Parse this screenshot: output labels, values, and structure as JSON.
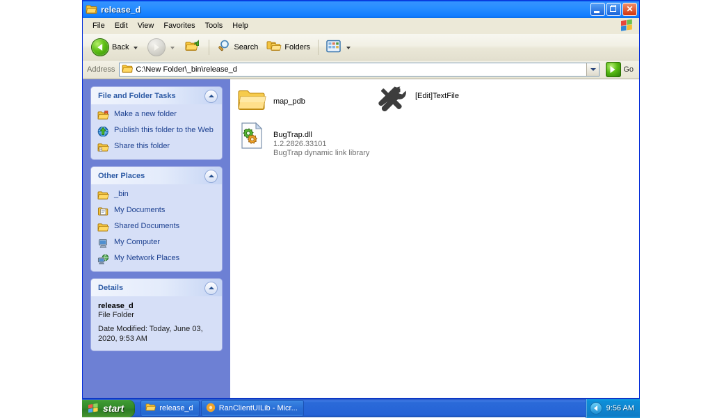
{
  "window": {
    "title": "release_d",
    "title_icon": "folder-icon",
    "controls": {
      "minimize": "Minimize",
      "restore": "Restore",
      "close": "Close"
    }
  },
  "menu": {
    "items": [
      {
        "label": "File",
        "name": "menu-file"
      },
      {
        "label": "Edit",
        "name": "menu-edit"
      },
      {
        "label": "View",
        "name": "menu-view"
      },
      {
        "label": "Favorites",
        "name": "menu-favorites"
      },
      {
        "label": "Tools",
        "name": "menu-tools"
      },
      {
        "label": "Help",
        "name": "menu-help"
      }
    ],
    "logo": "windows-flag-icon"
  },
  "toolbar": {
    "back_label": "Back",
    "forward_label": "",
    "up_label": "",
    "search_label": "Search",
    "folders_label": "Folders",
    "views_label": ""
  },
  "address": {
    "label": "Address",
    "value": "C:\\New Folder\\_bin\\release_d",
    "placeholder": "C:\\New Folder\\_bin\\release_d",
    "go_label": "Go"
  },
  "sidebar": {
    "panels": [
      {
        "title": "File and Folder Tasks",
        "name": "panel-file-and-folder-tasks",
        "items": [
          {
            "label": "Make a new folder",
            "icon": "new-folder-icon"
          },
          {
            "label": "Publish this folder to the Web",
            "icon": "publish-web-icon"
          },
          {
            "label": "Share this folder",
            "icon": "share-folder-icon"
          }
        ]
      },
      {
        "title": "Other Places",
        "name": "panel-other-places",
        "items": [
          {
            "label": "_bin",
            "icon": "folder-icon"
          },
          {
            "label": "My Documents",
            "icon": "my-documents-icon"
          },
          {
            "label": "Shared Documents",
            "icon": "shared-documents-icon"
          },
          {
            "label": "My Computer",
            "icon": "my-computer-icon"
          },
          {
            "label": "My Network Places",
            "icon": "network-places-icon"
          }
        ]
      },
      {
        "title": "Details",
        "name": "panel-details",
        "detail_name": "release_d",
        "detail_type": "File Folder",
        "detail_date": "Date Modified: Today, June 03, 2020, 9:53 AM"
      }
    ]
  },
  "files": [
    {
      "name": "map_pdb",
      "icon": "folder-icon",
      "version": "",
      "description": ""
    },
    {
      "name": "BugTrap.dll",
      "icon": "dll-gears-icon",
      "version": "1.2.2826.33101",
      "description": "BugTrap dynamic link library"
    },
    {
      "name": "[Edit]TextFile",
      "icon": "tools-wrench-screwdriver-icon",
      "version": "",
      "description": ""
    }
  ],
  "taskbar": {
    "start_label": "start",
    "tasks": [
      {
        "label": "release_d",
        "icon": "folder-icon"
      },
      {
        "label": "RanClientUILib - Micr...",
        "icon": "visual-studio-icon"
      }
    ],
    "clock": "9:56 AM"
  },
  "colors": {
    "title_blue": "#0058ee",
    "sidebar_blue": "#6d80d4",
    "panel_body": "#d6dff7",
    "link_blue": "#1b3f8f",
    "taskbar_blue": "#2462d6",
    "start_green": "#338a2a"
  }
}
